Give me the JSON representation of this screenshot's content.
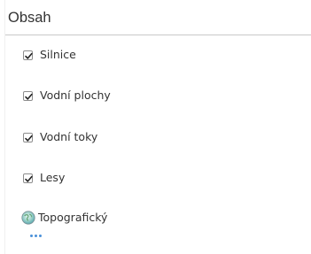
{
  "panel": {
    "title": "Obsah"
  },
  "layers": [
    {
      "label": "Silnice",
      "checked": true
    },
    {
      "label": "Vodní plochy",
      "checked": true
    },
    {
      "label": "Vodní toky",
      "checked": true
    },
    {
      "label": "Lesy",
      "checked": true
    }
  ],
  "basemap": {
    "label": "Topografický",
    "icon": "globe-icon"
  },
  "more": {
    "icon": "more-dots-icon"
  },
  "colors": {
    "accent": "#4a90d9",
    "text": "#333333",
    "divider": "#c9c9c9"
  }
}
